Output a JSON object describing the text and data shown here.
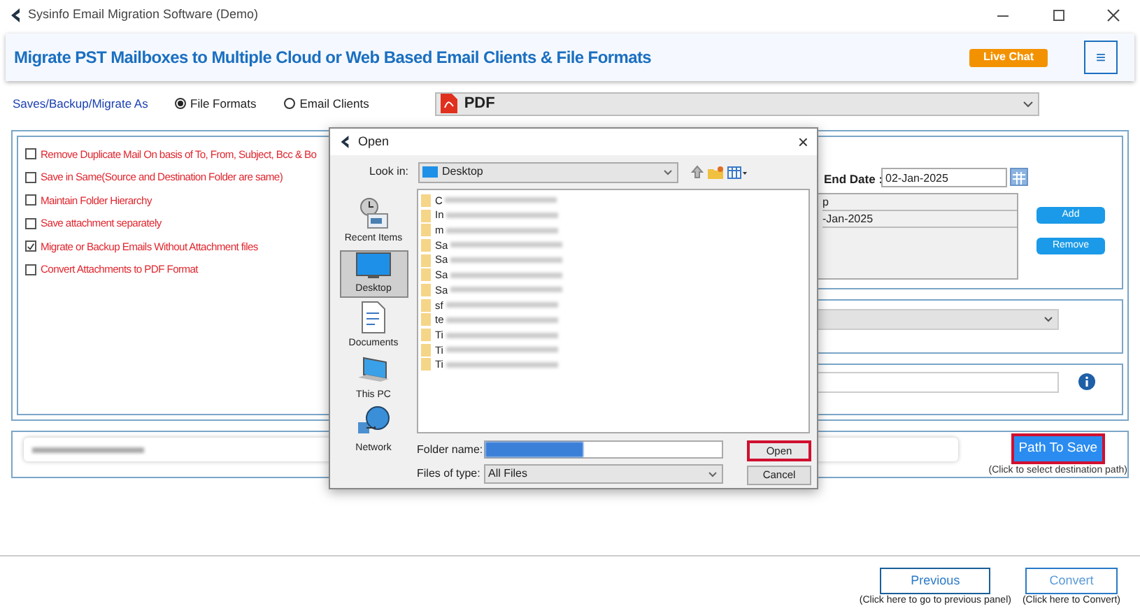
{
  "window": {
    "title": "Sysinfo Email Migration Software (Demo)"
  },
  "header": {
    "title": "Migrate PST Mailboxes to Multiple Cloud or Web Based Email Clients & File Formats",
    "live_chat": "Live Chat",
    "menu": "≡"
  },
  "save_as": {
    "label": "Saves/Backup/Migrate As",
    "options": [
      {
        "label": "File Formats",
        "selected": true
      },
      {
        "label": "Email Clients",
        "selected": false
      }
    ],
    "format": "PDF"
  },
  "options": [
    {
      "label": "Remove Duplicate Mail On basis of To, From, Subject, Bcc & Bo",
      "checked": false
    },
    {
      "label": "Save in Same(Source and Destination Folder are same)",
      "checked": false
    },
    {
      "label": "Maintain Folder Hierarchy",
      "checked": false
    },
    {
      "label": "Save attachment separately",
      "checked": false
    },
    {
      "label": "Migrate or Backup Emails Without Attachment files",
      "checked": true
    },
    {
      "label": "Convert Attachments to PDF Format",
      "checked": false
    }
  ],
  "date_filter": {
    "end_label": "End Date :",
    "end_value": "02-Jan-2025",
    "list": [
      "p",
      "-Jan-2025"
    ],
    "add": "Add",
    "remove": "Remove"
  },
  "path": {
    "button": "Path To Save",
    "hint": "(Click to select destination path)"
  },
  "footer": {
    "previous": "Previous",
    "previous_hint": "(Click here to go to previous panel)",
    "convert": "Convert",
    "convert_hint": "(Click here to Convert)"
  },
  "dialog": {
    "title": "Open",
    "close": "×",
    "look_in_label": "Look in:",
    "look_in": "Desktop",
    "places": [
      {
        "label": "Recent Items",
        "kind": "recent",
        "selected": false
      },
      {
        "label": "Desktop",
        "kind": "desktop",
        "selected": true
      },
      {
        "label": "Documents",
        "kind": "documents",
        "selected": false
      },
      {
        "label": "This PC",
        "kind": "pc",
        "selected": false
      },
      {
        "label": "Network",
        "kind": "network",
        "selected": false
      }
    ],
    "folders": [
      "C",
      "In",
      "m",
      "Sa",
      "Sa",
      "Sa",
      "Sa",
      "sf",
      "te",
      "Ti",
      "Ti",
      "Ti"
    ],
    "folder_name_label": "Folder name:",
    "files_of_type_label": "Files of type:",
    "files_of_type": "All Files",
    "open": "Open",
    "cancel": "Cancel"
  }
}
